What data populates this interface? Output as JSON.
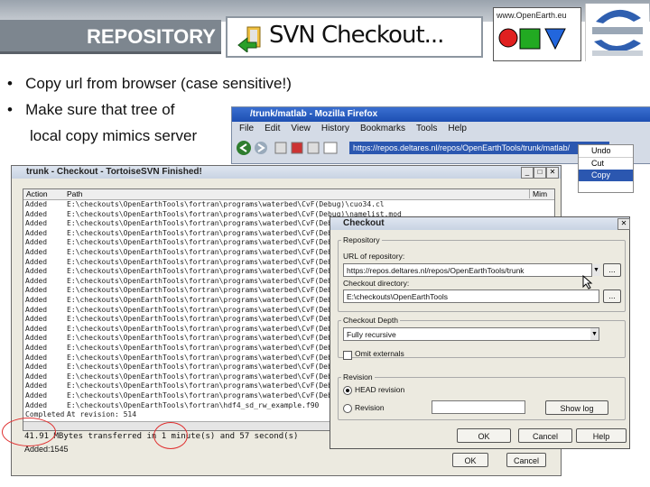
{
  "header": {
    "title": "REPOSITORY",
    "svn_title": "SVN Checkout...",
    "openearth_url": "www.OpenEarth.eu"
  },
  "bullets": [
    "Copy url from browser (case sensitive!)",
    "Make sure that tree of",
    "local copy mimics server"
  ],
  "firefox": {
    "title": "/trunk/matlab - Mozilla Firefox",
    "menu": [
      "File",
      "Edit",
      "View",
      "History",
      "Bookmarks",
      "Tools",
      "Help"
    ],
    "url": "https://repos.deltares.nl/repos/OpenEarthTools/trunk/matlab/",
    "context_menu": [
      "Undo",
      "Cut",
      "Copy"
    ]
  },
  "log_window": {
    "title": "trunk - Checkout - TortoiseSVN Finished!",
    "col_action": "Action",
    "col_path": "Path",
    "col_mime": "Mim",
    "rows": [
      {
        "action": "Added",
        "path": "E:\\checkouts\\OpenEarthTools\\fortran\\programs\\waterbed\\CvF(Debug)\\cuo34.cl"
      },
      {
        "action": "Added",
        "path": "E:\\checkouts\\OpenEarthTools\\fortran\\programs\\waterbed\\CvF(Debug)\\namelist.mod"
      },
      {
        "action": "Added",
        "path": "E:\\checkouts\\OpenEarthTools\\fortran\\programs\\waterbed\\CvF(Debug)\\Module"
      },
      {
        "action": "Added",
        "path": "E:\\checkouts\\OpenEarthTools\\fortran\\programs\\waterbed\\CvF(Debug)\\mpcor_"
      },
      {
        "action": "Added",
        "path": "E:\\checkouts\\OpenEarthTools\\fortran\\programs\\waterbed\\CvF(Debug)\\testmo"
      },
      {
        "action": "Added",
        "path": "E:\\checkouts\\OpenEarthTools\\fortran\\programs\\waterbed\\CvF(Debug)\\module_"
      },
      {
        "action": "Added",
        "path": "E:\\checkouts\\OpenEarthTools\\fortran\\programs\\waterbed\\CvF(Debug)\\waterbe"
      },
      {
        "action": "Added",
        "path": "E:\\checkouts\\OpenEarthTools\\fortran\\programs\\waterbed\\CvF(Debug)\\DF90.PD"
      },
      {
        "action": "Added",
        "path": "E:\\checkouts\\OpenEarthTools\\fortran\\programs\\waterbed\\CvF(Debug)\\bed.obj"
      },
      {
        "action": "Added",
        "path": "E:\\checkouts\\OpenEarthTools\\fortran\\programs\\waterbed\\CvF(Debug)\\matlab_"
      },
      {
        "action": "Added",
        "path": "E:\\checkouts\\OpenEarthTools\\fortran\\programs\\waterbed\\CvF(Debug)\\bed_mo"
      },
      {
        "action": "Added",
        "path": "E:\\checkouts\\OpenEarthTools\\fortran\\programs\\waterbed\\CvF(Debug)\\initilize.o"
      },
      {
        "action": "Added",
        "path": "E:\\checkouts\\OpenEarthTools\\fortran\\programs\\waterbed\\CvF(Debug)\\initiabe"
      },
      {
        "action": "Added",
        "path": "E:\\checkouts\\OpenEarthTools\\fortran\\programs\\waterbed\\CvF(Debug)\\wb_flux"
      },
      {
        "action": "Added",
        "path": "E:\\checkouts\\OpenEarthTools\\fortran\\programs\\waterbed\\CvF(Debug)\\waterbe"
      },
      {
        "action": "Added",
        "path": "E:\\checkouts\\OpenEarthTools\\fortran\\programs\\waterbed\\CvF(Debug)\\vc70.pdb"
      },
      {
        "action": "Added",
        "path": "E:\\checkouts\\OpenEarthTools\\fortran\\programs\\waterbed\\CvF(Debug)\\wb_flux"
      },
      {
        "action": "Added",
        "path": "E:\\checkouts\\OpenEarthTools\\fortran\\programs\\waterbed\\CvF(Debug)\\waterbed.dsw"
      },
      {
        "action": "Added",
        "path": "E:\\checkouts\\OpenEarthTools\\fortran\\programs\\waterbed\\CvF(Debug)\\DFdepth_plug.f90"
      },
      {
        "action": "Added",
        "path": "E:\\checkouts\\OpenEarthTools\\fortran\\programs\\waterbed\\CvF(Debug)\\waterbed.dsp"
      },
      {
        "action": "Added",
        "path": "E:\\checkouts\\OpenEarthTools\\fortran\\programs\\waterbed\\CvF(Debug)\\waterbed.png"
      },
      {
        "action": "Added",
        "path": "E:\\checkouts\\OpenEarthTools\\fortran\\hdf4_sd_rw_example.f90"
      },
      {
        "action": "Completed",
        "path": "At revision: 514"
      }
    ],
    "status_text": "41.91 MBytes transferred in 1 minute(s) and 57 second(s)",
    "added_text": "Added:1545",
    "ok": "OK",
    "cancel": "Cancel"
  },
  "checkout_dialog": {
    "title": "Checkout",
    "repository_group": "Repository",
    "url_label": "URL of repository:",
    "url_value": "https://repos.deltares.nl/repos/OpenEarthTools/trunk",
    "dir_label": "Checkout directory:",
    "dir_value": "E:\\checkouts\\OpenEarthTools",
    "browse": "...",
    "depth_group": "Checkout Depth",
    "depth_value": "Fully recursive",
    "omit_externals": "Omit externals",
    "revision_group": "Revision",
    "head_revision": "HEAD revision",
    "revision": "Revision",
    "show_log": "Show log",
    "ok": "OK",
    "cancel": "Cancel",
    "help": "Help"
  }
}
